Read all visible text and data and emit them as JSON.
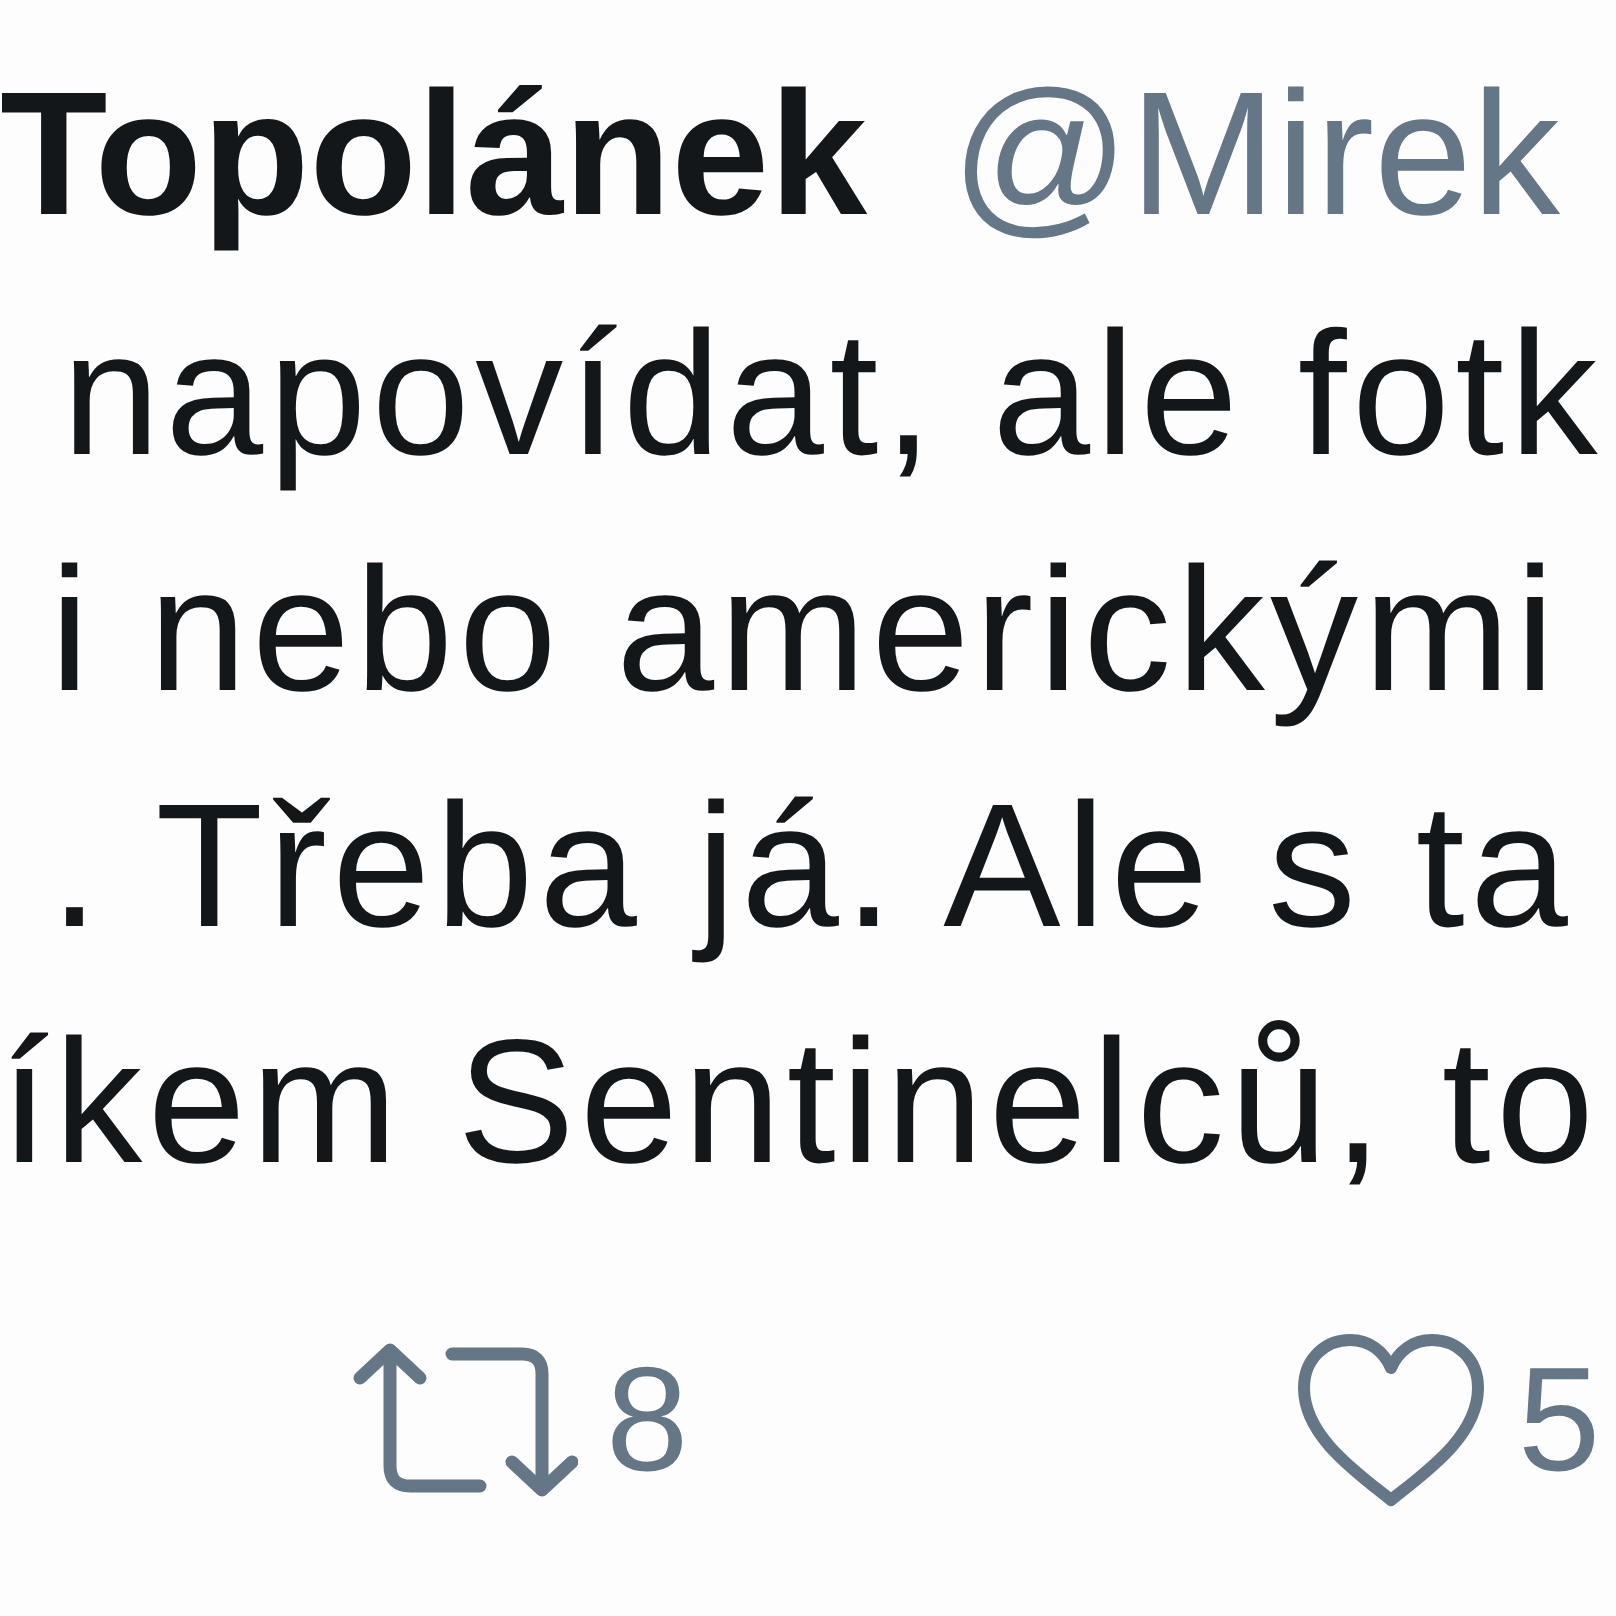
{
  "author": {
    "name": "Topolánek",
    "handle": "@Mirek"
  },
  "tweet": {
    "lines": [
      "napovídat, ale fotk",
      "i nebo americkými",
      ". Třeba já. Ale s ta",
      "íkem Sentinelců, to"
    ]
  },
  "actions": [
    {
      "kind": "retweet",
      "count": "8"
    },
    {
      "kind": "like",
      "count": "5"
    }
  ]
}
